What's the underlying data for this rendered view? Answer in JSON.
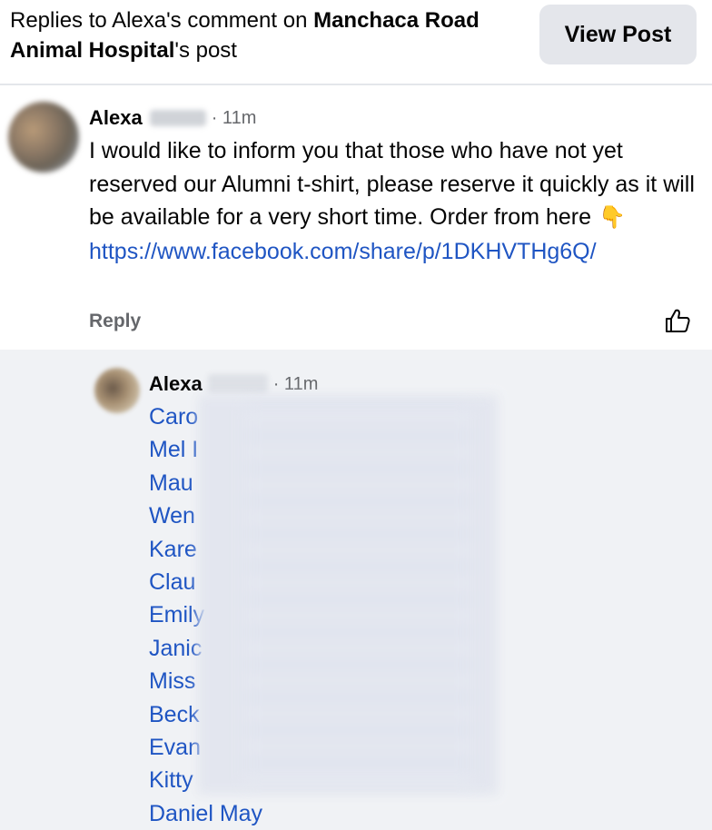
{
  "header": {
    "prefix": "Replies to Alexa's comment on ",
    "page_name": "Manchaca Road Animal Hospital",
    "suffix": "'s post",
    "view_post_label": "View Post"
  },
  "comment": {
    "author": "Alexa",
    "time": "· 11m",
    "text": "I would like to inform you that those who have not yet reserved our Alumni t-shirt, please reserve it quickly as it will be available for a very short time. Order from here",
    "emoji": "👇",
    "link": "https://www.facebook.com/share/p/1DKHVTHg6Q/",
    "reply_label": "Reply",
    "like_icon": "thumbs-up-outline-icon"
  },
  "reply": {
    "author": "Alexa",
    "time": "· 11m",
    "tags": [
      "Caro",
      "Mel I",
      "Mau",
      "Wen",
      "Kare",
      "Clau",
      "Emily",
      "Janic",
      "Miss",
      "Beck",
      "Evan",
      "Kitty",
      "Daniel May"
    ]
  },
  "colors": {
    "link": "#1f55c3",
    "secondary_text": "#65676b",
    "reply_background": "#f0f2f5",
    "button_background": "#e4e6eb"
  }
}
